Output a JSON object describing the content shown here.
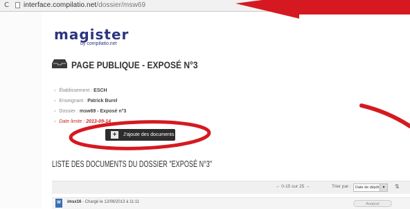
{
  "browser": {
    "reload_icon": "reload-icon",
    "url_host": "interface.compilatio.net",
    "url_path": "/dossier/msw69"
  },
  "brand": {
    "name": "magister",
    "tagline": "by compilatio.net"
  },
  "page": {
    "title": "PAGE PUBLIQUE - EXPOSÉ N°3",
    "title_icon": "inbox-tray-icon"
  },
  "info": [
    {
      "label": "Établissement : ",
      "value": "ESCH"
    },
    {
      "label": "Enseignant : ",
      "value": "Patrick Burel"
    },
    {
      "label": "Dossier : ",
      "value": "msw69 - Exposé n°3"
    },
    {
      "label": "Date limite : ",
      "value": "2013-09-14"
    }
  ],
  "add_button": {
    "label": "J'ajoute des documents",
    "icon": "plus-icon"
  },
  "list": {
    "title": "LISTE DES DOCUMENTS DU DOSSIER \"EXPOSÉ N°3\"",
    "pager": "←  0-15 sur 25  →",
    "sort_label": "Trier par :",
    "sort_value": "Date de dépôt",
    "sort_icon": "sort-icon"
  },
  "documents": [
    {
      "name": "imsx16",
      "uploaded": " - Chargé le 12/09/2013 à 11:11",
      "status": "Analysé",
      "icon": "doc-icon"
    }
  ],
  "annotations": {
    "color": "#d61920"
  }
}
